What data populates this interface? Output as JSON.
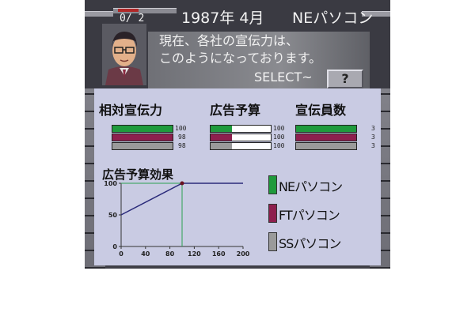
{
  "header": {
    "turn": "0/ 2",
    "date": "1987年 4月",
    "company": "NEパソコン",
    "message_line1": "現在、各社の宣伝力は、",
    "message_line2": "このようになっております。",
    "select_label": "SELECT~",
    "help_button": "?"
  },
  "stats": {
    "title_relative": "相対宣伝力",
    "title_budget": "広告予算",
    "title_staff": "宣伝員数",
    "relative": [
      100,
      98,
      98
    ],
    "budget": [
      100,
      100,
      100
    ],
    "budget_fill": [
      0.35,
      0.35,
      0.35
    ],
    "staff": [
      3,
      3,
      3
    ]
  },
  "companies": [
    {
      "name": "NEパソコン",
      "color": "#1f9a3c"
    },
    {
      "name": "FTパソコン",
      "color": "#8e1f4e"
    },
    {
      "name": "SSパソコン",
      "color": "#9a9a9a"
    }
  ],
  "chart_data": {
    "type": "line",
    "title": "広告予算効果",
    "x": [
      0,
      100,
      200
    ],
    "y": [
      50,
      100,
      100
    ],
    "xticks": [
      "0",
      "40",
      "80",
      "120",
      "160",
      "200"
    ],
    "yticks": [
      "0",
      "50",
      "100"
    ],
    "xlim": [
      0,
      200
    ],
    "ylim": [
      0,
      100
    ],
    "marker": {
      "x": 100,
      "y": 100
    },
    "line_color": "#2a2a7a",
    "guide_color": "#2aa050"
  }
}
